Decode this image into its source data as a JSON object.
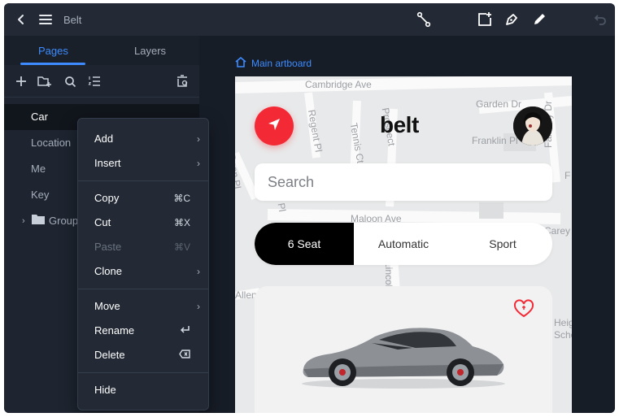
{
  "window": {
    "title": "Belt"
  },
  "sidebar": {
    "tabs": [
      {
        "label": "Pages"
      },
      {
        "label": "Layers"
      }
    ],
    "pages": [
      {
        "label": "Car"
      },
      {
        "label": "Location"
      },
      {
        "label": "Me"
      },
      {
        "label": "Key"
      }
    ],
    "group": {
      "label": "Group"
    }
  },
  "context_menu": {
    "add": "Add",
    "insert": "Insert",
    "copy": {
      "label": "Copy",
      "shortcut": "⌘C"
    },
    "cut": {
      "label": "Cut",
      "shortcut": "⌘X"
    },
    "paste": {
      "label": "Paste",
      "shortcut": "⌘V"
    },
    "clone": "Clone",
    "move": "Move",
    "rename": "Rename",
    "delete": "Delete",
    "hide": "Hide"
  },
  "canvas": {
    "artboard_label": "Main artboard",
    "app": {
      "logo": "belt",
      "search_placeholder": "Search",
      "segments": [
        {
          "label": "6 Seat"
        },
        {
          "label": "Automatic"
        },
        {
          "label": "Sport"
        }
      ],
      "map_labels": {
        "cambridge": "Cambridge Ave",
        "garden": "Garden Dr",
        "franklin": "Franklin Pl",
        "fairway": "Fairway Dr",
        "regent": "Regent Pl",
        "tennis": "Tennis Ct",
        "prospect": "Prospect",
        "maloon": "Maloon Ave",
        "lincoln": "Lincoln",
        "carey": "Carey",
        "school": "School",
        "allen": "Allen",
        "dean": "Dean Pl",
        "heights": "Heights",
        "pl": "Pl",
        "f": "F"
      }
    }
  },
  "colors": {
    "accent": "#3d8bff",
    "brand_red": "#f32a35",
    "dark_bg": "#161b24"
  }
}
